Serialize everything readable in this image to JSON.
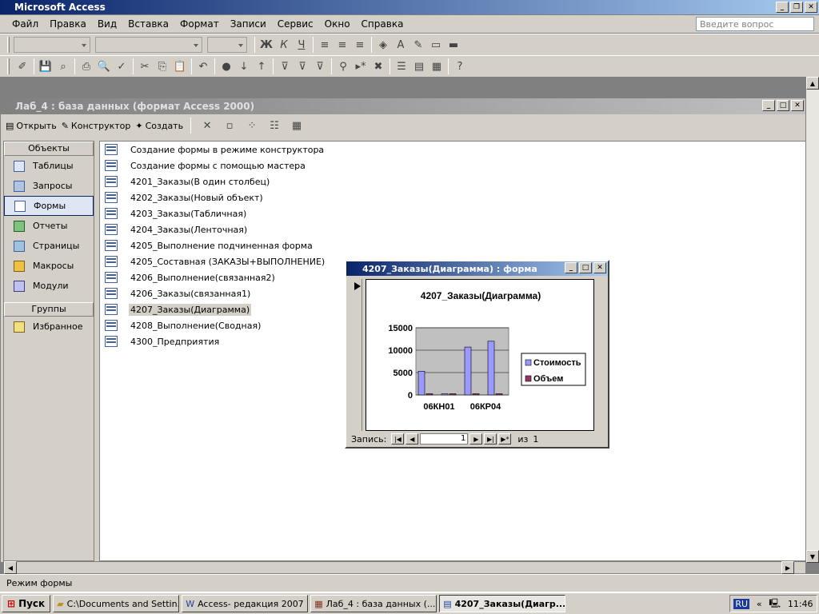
{
  "app": {
    "title": "Microsoft Access",
    "ask_placeholder": "Введите вопрос"
  },
  "menu": [
    "Файл",
    "Правка",
    "Вид",
    "Вставка",
    "Формат",
    "Записи",
    "Сервис",
    "Окно",
    "Справка"
  ],
  "db_window": {
    "title": "Лаб_4 : база данных (формат Access 2000)",
    "toolbar": {
      "open": "Открыть",
      "design": "Конструктор",
      "create": "Создать"
    },
    "objects_header": "Объекты",
    "objects": [
      "Таблицы",
      "Запросы",
      "Формы",
      "Отчеты",
      "Страницы",
      "Макросы",
      "Модули"
    ],
    "selected_object": "Формы",
    "groups_header": "Группы",
    "groups": [
      "Избранное"
    ],
    "items": [
      "Создание формы в режиме конструктора",
      "Создание формы с помощью мастера",
      "4201_Заказы(В один столбец)",
      "4202_Заказы(Новый объект)",
      "4203_Заказы(Табличная)",
      "4204_Заказы(Ленточная)",
      "4205_Выполнение подчиненная форма",
      "4205_Составная (ЗАКАЗЫ+ВЫПОЛНЕНИЕ)",
      "4206_Выполнение(связанная2)",
      "4206_Заказы(связанная1)",
      "4207_Заказы(Диаграмма)",
      "4208_Выполнение(Сводная)",
      "4300_Предприятия"
    ],
    "selected_item": "4207_Заказы(Диаграмма)"
  },
  "form_window": {
    "title": "4207_Заказы(Диаграмма) : форма",
    "nav": {
      "label": "Запись:",
      "current": "1",
      "of_label": "из",
      "total": "1"
    }
  },
  "chart_data": {
    "type": "bar",
    "title": "4207_Заказы(Диаграмма)",
    "categories": [
      "06КН01",
      "",
      "06КР04",
      ""
    ],
    "series": [
      {
        "name": "Стоимость",
        "values": [
          5300,
          0,
          10700,
          12000
        ],
        "color": "#9999ff"
      },
      {
        "name": "Объем",
        "values": [
          0,
          0,
          0,
          0
        ],
        "color": "#993366"
      }
    ],
    "yticks": [
      "15000",
      "10000",
      "5000",
      "0"
    ],
    "ylim": [
      0,
      15000
    ],
    "legend_position": "right"
  },
  "status": {
    "mode": "Режим формы"
  },
  "taskbar": {
    "start": "Пуск",
    "tasks": [
      "C:\\Documents and Settin...",
      "Access- редакция 2007 ...",
      "Лаб_4 : база данных (...",
      "4207_Заказы(Диагр..."
    ],
    "lang": "RU",
    "time": "11:46"
  }
}
